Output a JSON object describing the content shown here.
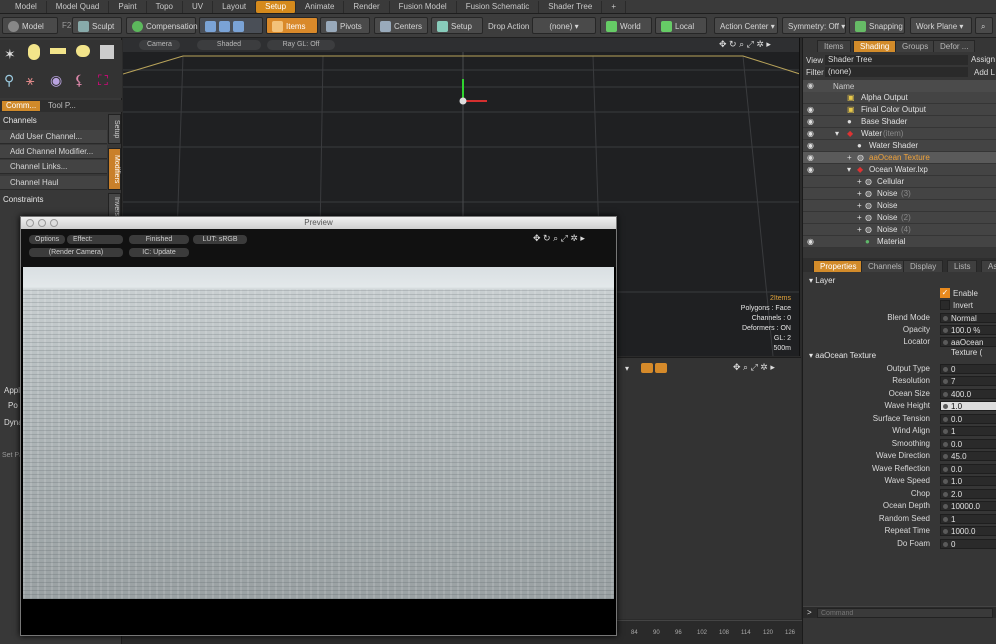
{
  "topbar": {
    "tabs": [
      {
        "label": "Model"
      },
      {
        "label": "Model Quad"
      },
      {
        "label": "Paint"
      },
      {
        "label": "Topo"
      },
      {
        "label": "UV"
      },
      {
        "label": "Layout"
      },
      {
        "label": "Setup"
      },
      {
        "label": "Animate"
      },
      {
        "label": "Render"
      },
      {
        "label": "Fusion Model"
      },
      {
        "label": "Fusion Schematic"
      },
      {
        "label": "Shader Tree"
      },
      {
        "label": "+"
      }
    ]
  },
  "toolbar": {
    "mode_label": "Model",
    "shortcut": "F2",
    "sculpt_label": "Sculpt",
    "compensation_label": "Compensation",
    "items_label": "Items",
    "pivots_label": "Pivots",
    "centers_label": "Centers",
    "setup_label": "Setup",
    "drop_action_label": "Drop Action",
    "drop_action_value": "(none)",
    "world_label": "World",
    "local_label": "Local",
    "action_center_label": "Action Center",
    "symmetry_label": "Symmetry: Off",
    "snapping_label": "Snapping",
    "work_plane_label": "Work Plane"
  },
  "left": {
    "tab_commands": "Comm...",
    "tab_tool": "Tool P...",
    "channels_header": "Channels",
    "items": [
      "Add User Channel...",
      "Add Channel Modifier...",
      "Channel Links...",
      "Channel Haul"
    ],
    "constraints_header": "Constraints",
    "vtab_setup": "Setup",
    "vtab_modifiers": "Modifiers",
    "vtab_inverse": "Inverse",
    "appl": "Appl",
    "dyna": "Dyna",
    "po": "Po",
    "setpa": "Set Pa"
  },
  "viewport": {
    "camera": "Camera",
    "shaded": "Shaded",
    "raygl": "Ray GL: Off",
    "stats": [
      "2Items",
      "Polygons : Face",
      "Channels : 0",
      "Deformers : ON",
      "GL: 2",
      "500m"
    ]
  },
  "preview": {
    "title": "Preview",
    "options": "Options",
    "effect": "Effect: (Shadin...",
    "finished": "Finished",
    "lut": "LUT: sRGB",
    "render_camera": "(Render Camera)",
    "ic_update": "IC: Update"
  },
  "right": {
    "tabs": [
      "Items",
      "Shading",
      "Groups",
      "Defor ..."
    ],
    "view_label": "View",
    "view_value": "Shader Tree",
    "assign": "Assign",
    "filter_label": "Filter",
    "filter_value": "(none)",
    "add_layer": "Add L",
    "name_header": "Name",
    "tree": [
      {
        "label": "Alpha Output"
      },
      {
        "label": "Final Color Output"
      },
      {
        "label": "Base Shader"
      },
      {
        "label": "Water",
        "suffix": "(item)"
      },
      {
        "label": "Water Shader"
      },
      {
        "label": "aaOcean Texture"
      },
      {
        "label": "Ocean Water.lxp"
      },
      {
        "label": "Cellular"
      },
      {
        "label": "Noise",
        "suffix": "(3)"
      },
      {
        "label": "Noise"
      },
      {
        "label": "Noise",
        "suffix": "(2)"
      },
      {
        "label": "Noise",
        "suffix": "(4)"
      },
      {
        "label": "Material"
      }
    ],
    "prop_tabs": [
      "Properties",
      "Channels",
      "Display",
      "Lists",
      "Asse"
    ],
    "layer_header": "Layer",
    "enable": "Enable",
    "invert": "Invert",
    "blend_mode_label": "Blend Mode",
    "blend_mode_value": "Normal",
    "opacity_label": "Opacity",
    "opacity_value": "100.0 %",
    "locator_label": "Locator",
    "locator_value": "aaOcean Texture (",
    "aaocean_header": "aaOcean Texture",
    "props": [
      {
        "label": "Output Type",
        "value": "0"
      },
      {
        "label": "Resolution",
        "value": "7"
      },
      {
        "label": "Ocean Size",
        "value": "400.0"
      },
      {
        "label": "Wave Height",
        "value": "1.0"
      },
      {
        "label": "Surface Tension",
        "value": "0.0"
      },
      {
        "label": "Wind Align",
        "value": "1"
      },
      {
        "label": "Smoothing",
        "value": "0.0"
      },
      {
        "label": "Wave Direction",
        "value": "45.0"
      },
      {
        "label": "Wave Reflection",
        "value": "0.0"
      },
      {
        "label": "Wave Speed",
        "value": "1.0"
      },
      {
        "label": "Chop",
        "value": "2.0"
      },
      {
        "label": "Ocean Depth",
        "value": "10000.0"
      },
      {
        "label": "Random Seed",
        "value": "1"
      },
      {
        "label": "Repeat Time",
        "value": "1000.0"
      },
      {
        "label": "Do Foam",
        "value": "0"
      }
    ],
    "command_placeholder": "Command"
  },
  "timeline": {
    "ticks": [
      "84",
      "90",
      "96",
      "102",
      "108",
      "114",
      "120",
      "126"
    ]
  }
}
